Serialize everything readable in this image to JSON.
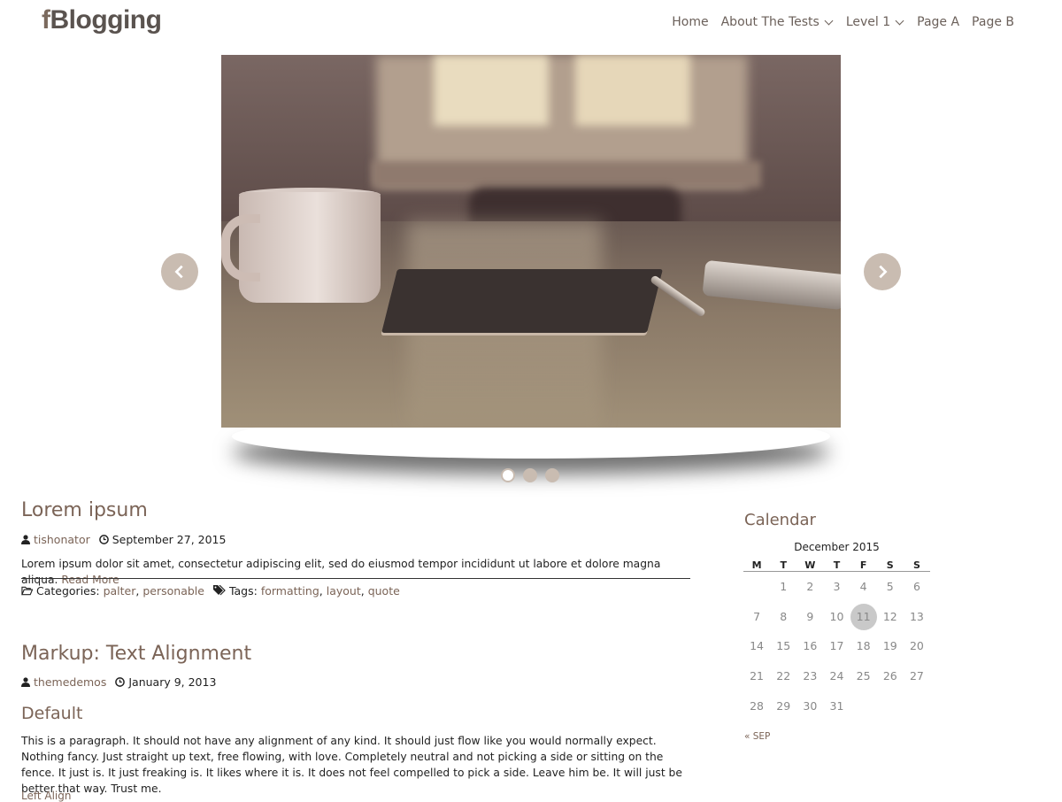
{
  "site": {
    "logo_f": "f",
    "logo_rest": "Blogging"
  },
  "nav": {
    "items": [
      {
        "label": "Home",
        "dropdown": false
      },
      {
        "label": "About The Tests",
        "dropdown": true
      },
      {
        "label": "Level 1",
        "dropdown": true
      },
      {
        "label": "Page A",
        "dropdown": false
      },
      {
        "label": "Page B",
        "dropdown": false
      }
    ]
  },
  "slider": {
    "slides": 3,
    "active": 0
  },
  "posts": [
    {
      "title": "Lorem ipsum",
      "author": "tishonator",
      "date": "September 27, 2015",
      "excerpt": "Lorem ipsum dolor sit amet, consectetur adipiscing elit, sed do eiusmod tempor incididunt ut labore et dolore magna aliqua.",
      "read_more": "Read More",
      "categories_label": "Categories:",
      "categories": [
        "palter",
        "personable"
      ],
      "tags_label": "Tags:",
      "tags": [
        "formatting",
        "layout",
        "quote"
      ]
    },
    {
      "title": "Markup: Text Alignment",
      "author": "themedemos",
      "date": "January 9, 2013",
      "subheading": "Default",
      "excerpt": "This is a paragraph. It should not have any alignment of any kind. It should just flow like you would normally expect. Nothing fancy. Just straight up text, free flowing, with love. Completely neutral and not picking a side or sitting on the fence. It just is. It just freaking is. It likes where it is. It does not feel compelled to pick a side. Leave him be. It will just be better that way. Trust me.",
      "trailing_text": "Left Align"
    }
  ],
  "sidebar": {
    "calendar": {
      "title": "Calendar",
      "caption": "December 2015",
      "weekdays": [
        "M",
        "T",
        "W",
        "T",
        "F",
        "S",
        "S"
      ],
      "weeks": [
        [
          "",
          "1",
          "2",
          "3",
          "4",
          "5",
          "6"
        ],
        [
          "7",
          "8",
          "9",
          "10",
          "11",
          "12",
          "13"
        ],
        [
          "14",
          "15",
          "16",
          "17",
          "18",
          "19",
          "20"
        ],
        [
          "21",
          "22",
          "23",
          "24",
          "25",
          "26",
          "27"
        ],
        [
          "28",
          "29",
          "30",
          "31",
          "",
          "",
          ""
        ]
      ],
      "today": "11",
      "prev_link": "« SEP"
    }
  },
  "colors": {
    "accent": "#7b6457",
    "slider_control": "#c9bcb1",
    "text": "#222222"
  }
}
